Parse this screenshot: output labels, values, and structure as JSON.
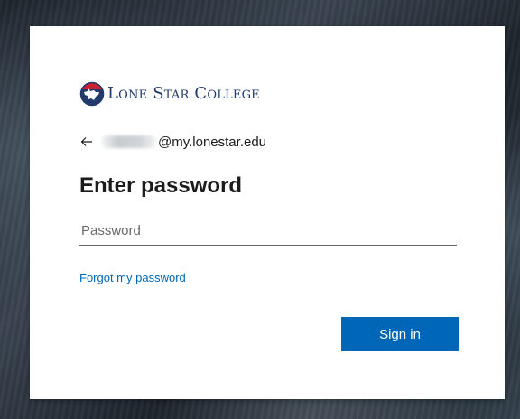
{
  "logo": {
    "text": "Lone Star College"
  },
  "identity": {
    "back_icon": "arrow-left-icon",
    "email_domain": "@my.lonestar.edu"
  },
  "title": "Enter password",
  "password": {
    "placeholder": "Password",
    "value": ""
  },
  "forgot_link": "Forgot my password",
  "signin_button": "Sign in",
  "colors": {
    "brand_navy": "#213a6b",
    "brand_red": "#c8202f",
    "link_blue": "#0067b8",
    "button_blue": "#0067b8"
  }
}
